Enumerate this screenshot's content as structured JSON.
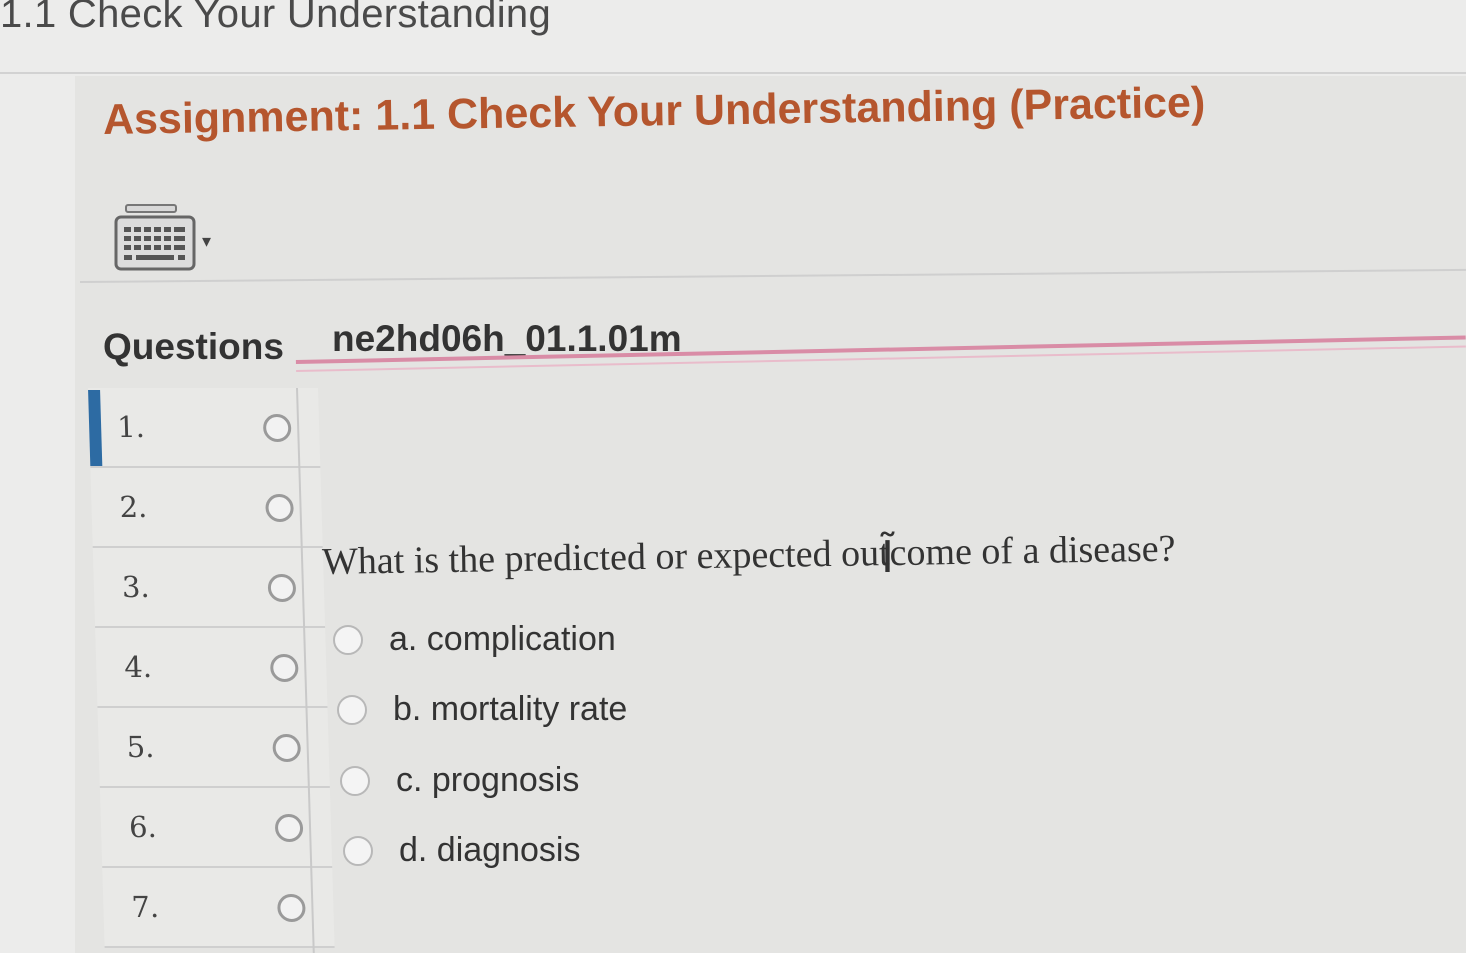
{
  "page": {
    "title": "1.1 Check Your Understanding"
  },
  "assignment": {
    "title": "Assignment: 1.1 Check Your Understanding (Practice)"
  },
  "toolbar": {
    "keyboard_icon": "keyboard-icon",
    "caret_icon": "caret-down-icon",
    "caret_glyph": "▾"
  },
  "questions_panel": {
    "heading": "Questions",
    "items": [
      {
        "number": "1.",
        "active": true
      },
      {
        "number": "2.",
        "active": false
      },
      {
        "number": "3.",
        "active": false
      },
      {
        "number": "4.",
        "active": false
      },
      {
        "number": "5.",
        "active": false
      },
      {
        "number": "6.",
        "active": false
      },
      {
        "number": "7.",
        "active": false
      }
    ]
  },
  "question": {
    "id": "ne2hd06h_01.1.01m",
    "text": "What is the predicted or expected outcome of a disease?",
    "answers": [
      {
        "label": "a. complication"
      },
      {
        "label": "b. mortality rate"
      },
      {
        "label": "c. prognosis"
      },
      {
        "label": "d. diagnosis"
      }
    ]
  },
  "colors": {
    "assignment_title": "#b5562e",
    "active_marker": "#2d6ba3",
    "tab_underline": "#d98ca6"
  },
  "cursor": {
    "icon": "text-cursor-icon",
    "glyph": "Ĩ"
  }
}
